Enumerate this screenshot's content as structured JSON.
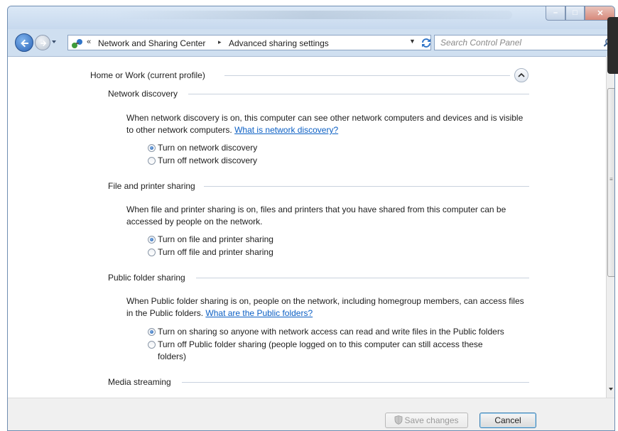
{
  "window": {
    "controls": [
      "minimize",
      "maximize",
      "close"
    ]
  },
  "address_bar": {
    "overflow_chevron": "«",
    "breadcrumbs": [
      {
        "label": "Network and Sharing Center"
      },
      {
        "label": "Advanced sharing settings"
      }
    ],
    "separator": "▸"
  },
  "search": {
    "placeholder": "Search Control Panel",
    "value": ""
  },
  "profile": {
    "title": "Home or Work (current profile)",
    "expanded": true
  },
  "sections": [
    {
      "heading": "Network discovery",
      "description": "When network discovery is on, this computer can see other network computers and devices and is visible to other network computers.",
      "link": "What is network discovery?",
      "options": [
        {
          "label": "Turn on network discovery",
          "checked": true
        },
        {
          "label": "Turn off network discovery",
          "checked": false
        }
      ]
    },
    {
      "heading": "File and printer sharing",
      "description": "When file and printer sharing is on, files and printers that you have shared from this computer can be accessed by people on the network.",
      "link": "",
      "options": [
        {
          "label": "Turn on file and printer sharing",
          "checked": true
        },
        {
          "label": "Turn off file and printer sharing",
          "checked": false
        }
      ]
    },
    {
      "heading": "Public folder sharing",
      "description": "When Public folder sharing is on, people on the network, including homegroup members, can access files in the Public folders.",
      "link": "What are the Public folders?",
      "options": [
        {
          "label": "Turn on sharing so anyone with network access can read and write files in the Public folders",
          "checked": true
        },
        {
          "label": "Turn off Public folder sharing (people logged on to this computer can still access these",
          "label_line2": "folders)",
          "checked": false
        }
      ]
    },
    {
      "heading": "Media streaming"
    }
  ],
  "footer": {
    "save_label": "Save changes",
    "save_enabled": false,
    "cancel_label": "Cancel"
  },
  "icons": {
    "back": "back-arrow-icon",
    "forward": "forward-arrow-icon",
    "network": "network-icon",
    "refresh": "refresh-icon",
    "search": "search-icon",
    "collapse": "chevron-up-icon",
    "uac_shield": "uac-shield-icon"
  },
  "colors": {
    "link": "#0b5fc4",
    "frame": "#cfdff0",
    "close_button": "#d7897b"
  }
}
